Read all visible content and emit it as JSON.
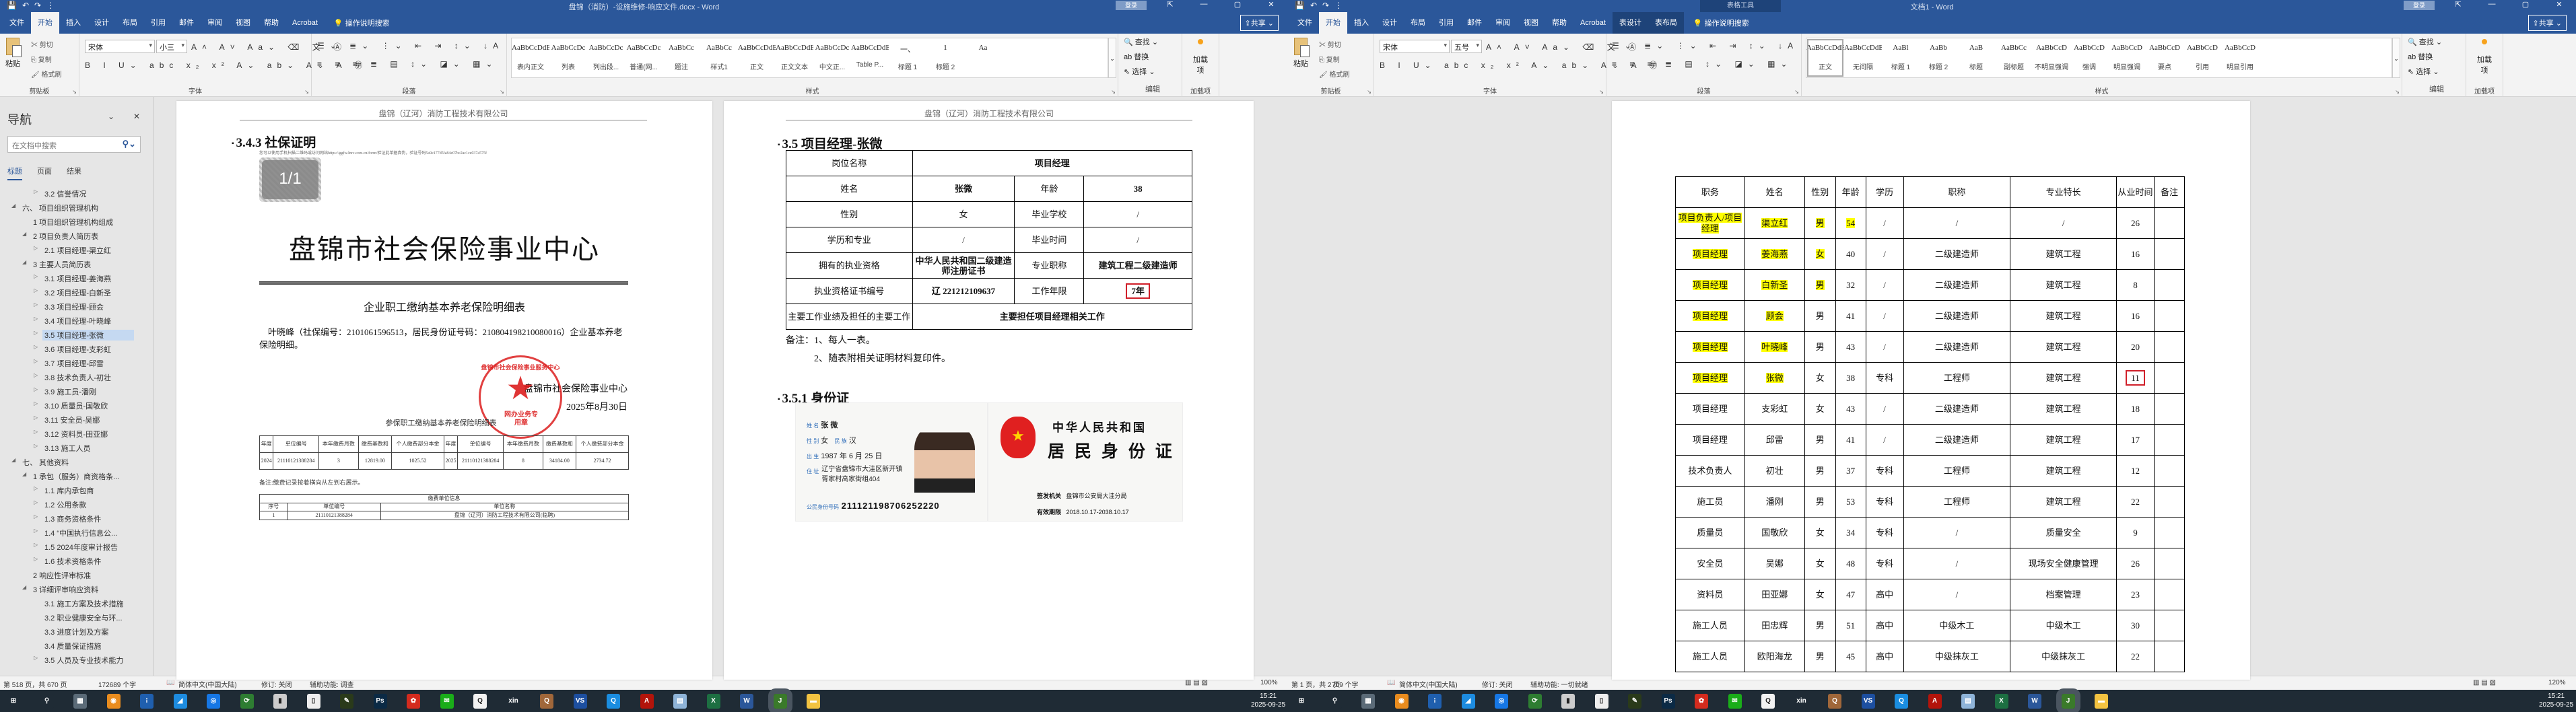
{
  "windows": {
    "left": {
      "title": "盘锦（消防）-设施维修-响应文件.docx - Word",
      "quick_access": [
        "save-icon",
        "undo-icon",
        "redo-icon",
        "customize-icon"
      ],
      "login": "登录",
      "share": "共享",
      "tabs": [
        "文件",
        "开始",
        "插入",
        "设计",
        "布局",
        "引用",
        "邮件",
        "审阅",
        "视图",
        "帮助",
        "Acrobat"
      ],
      "active_tab": "开始",
      "tell_me": "操作说明搜索",
      "ribbon": {
        "paste": "粘贴",
        "cut": "剪切",
        "copy": "复制",
        "format_painter": "格式刷",
        "clipboard_label": "剪贴板",
        "font_name": "宋体",
        "font_size": "小三",
        "font_label": "字体",
        "paragraph_label": "段落",
        "styles_label": "样式",
        "styles": [
          {
            "preview": "AaBbCcDdE",
            "name": "表内正文"
          },
          {
            "preview": "AaBbCcDc",
            "name": "列表"
          },
          {
            "preview": "AaBbCcDc",
            "name": "列出段..."
          },
          {
            "preview": "AaBbCcDc",
            "name": "普通(网..."
          },
          {
            "preview": "AaBbCc",
            "name": "题注"
          },
          {
            "preview": "AaBbCc",
            "name": "样式1"
          },
          {
            "preview": "AaBbCcDdE",
            "name": "正文"
          },
          {
            "preview": "AaBbCcDdE",
            "name": "正文文本"
          },
          {
            "preview": "AaBbCcDc",
            "name": "中文正..."
          },
          {
            "preview": "AaBbCcDdE",
            "name": "Table P..."
          },
          {
            "preview": "一、",
            "name": "标题 1"
          },
          {
            "preview": "1",
            "name": "标题 2"
          },
          {
            "preview": "Aa",
            "name": ""
          }
        ],
        "find": "查找",
        "replace": "替换",
        "select": "选择",
        "editing_label": "编辑",
        "addins_button": "加载项",
        "addins_label": "加载项"
      },
      "status": {
        "page": "第 518 页，共 670 页",
        "words": "172689 个字",
        "language": "简体中文(中国大陆)",
        "track": "修订: 关闭",
        "accessibility": "辅助功能: 调查",
        "zoom": "100%"
      }
    },
    "right": {
      "title": "文档1 - Word",
      "contextual": "表格工具",
      "quick_access": [
        "save-icon",
        "undo-icon",
        "redo-icon",
        "customize-icon"
      ],
      "login": "登录",
      "share": "共享",
      "tabs": [
        "文件",
        "开始",
        "插入",
        "设计",
        "布局",
        "引用",
        "邮件",
        "审阅",
        "视图",
        "帮助",
        "Acrobat",
        "表设计",
        "表布局"
      ],
      "active_tab": "开始",
      "tell_me": "操作说明搜索",
      "ribbon": {
        "paste": "粘贴",
        "cut": "剪切",
        "copy": "复制",
        "format_painter": "格式刷",
        "clipboard_label": "剪贴板",
        "font_name": "宋体",
        "font_size": "五号",
        "font_label": "字体",
        "paragraph_label": "段落",
        "styles_label": "样式",
        "styles": [
          {
            "preview": "AaBbCcDdE",
            "name": "正文"
          },
          {
            "preview": "AaBbCcDdE",
            "name": "无间隔"
          },
          {
            "preview": "AaBl",
            "name": "标题 1"
          },
          {
            "preview": "AaBb",
            "name": "标题 2"
          },
          {
            "preview": "AaB",
            "name": "标题"
          },
          {
            "preview": "AaBbCc",
            "name": "副标题"
          },
          {
            "preview": "AaBbCcD",
            "name": "不明显强调"
          },
          {
            "preview": "AaBbCcD",
            "name": "强调"
          },
          {
            "preview": "AaBbCcD",
            "name": "明显强调"
          },
          {
            "preview": "AaBbCcD",
            "name": "要点"
          },
          {
            "preview": "AaBbCcD",
            "name": "引用"
          },
          {
            "preview": "AaBbCcD",
            "name": "明显引用"
          }
        ],
        "find": "查找",
        "replace": "替换",
        "select": "选择",
        "editing_label": "编辑",
        "addins_button": "加载项",
        "addins_label": "加载项"
      },
      "status": {
        "page": "第 1 页，共 2 页",
        "words": "709 个字",
        "language": "简体中文(中国大陆)",
        "track": "修订: 关闭",
        "accessibility": "辅助功能: 一切就绪",
        "zoom": "120%"
      }
    }
  },
  "nav": {
    "title": "导航",
    "search_placeholder": "在文档中搜索",
    "tabs": [
      "标题",
      "页面",
      "结果"
    ],
    "items": [
      {
        "label": "3.2 信誉情况",
        "level": 3,
        "state": "collapsed"
      },
      {
        "label": "六、 项目组织管理机构",
        "level": 1,
        "state": "expanded"
      },
      {
        "label": "1 项目组织管理机构组成",
        "level": 2,
        "state": "none"
      },
      {
        "label": "2 项目负责人简历表",
        "level": 2,
        "state": "expanded"
      },
      {
        "label": "2.1 项目经理-渠立红",
        "level": 3,
        "state": "collapsed"
      },
      {
        "label": "3 主要人员简历表",
        "level": 2,
        "state": "expanded"
      },
      {
        "label": "3.1 项目经理-姜海燕",
        "level": 3,
        "state": "collapsed"
      },
      {
        "label": "3.2 项目经理-白新圣",
        "level": 3,
        "state": "collapsed"
      },
      {
        "label": "3.3 项目经理-顾会",
        "level": 3,
        "state": "collapsed"
      },
      {
        "label": "3.4 项目经理-叶晓峰",
        "level": 3,
        "state": "collapsed"
      },
      {
        "label": "3.5 项目经理-张微",
        "level": 3,
        "state": "collapsed",
        "selected": true
      },
      {
        "label": "3.6 项目经理-支彩虹",
        "level": 3,
        "state": "collapsed"
      },
      {
        "label": "3.7 项目经理-邱雷",
        "level": 3,
        "state": "collapsed"
      },
      {
        "label": "3.8 技术负责人-初壮",
        "level": 3,
        "state": "collapsed"
      },
      {
        "label": "3.9 施工员-潘刚",
        "level": 3,
        "state": "collapsed"
      },
      {
        "label": "3.10 质量员-国敬欣",
        "level": 3,
        "state": "collapsed"
      },
      {
        "label": "3.11 安全员-吴娜",
        "level": 3,
        "state": "collapsed"
      },
      {
        "label": "3.12 资料员-田亚娜",
        "level": 3,
        "state": "collapsed"
      },
      {
        "label": "3.13 施工人员",
        "level": 3,
        "state": "collapsed"
      },
      {
        "label": "七、 其他资料",
        "level": 1,
        "state": "expanded"
      },
      {
        "label": "1 承包（服务）商资格条...",
        "level": 2,
        "state": "expanded"
      },
      {
        "label": "1.1 库内承包商",
        "level": 3,
        "state": "collapsed"
      },
      {
        "label": "1.2 公用条款",
        "level": 3,
        "state": "collapsed"
      },
      {
        "label": "1.3 商务资格条件",
        "level": 3,
        "state": "collapsed"
      },
      {
        "label": "1.4 “中国执行信息公...",
        "level": 3,
        "state": "collapsed"
      },
      {
        "label": "1.5 2024年度审计报告",
        "level": 3,
        "state": "collapsed"
      },
      {
        "label": "1.6 技术资格条件",
        "level": 3,
        "state": "collapsed"
      },
      {
        "label": "2 响应性评审标准",
        "level": 2,
        "state": "none"
      },
      {
        "label": "3 详细评审响应资料",
        "level": 2,
        "state": "expanded"
      },
      {
        "label": "3.1 施工方案及技术措施",
        "level": 3,
        "state": "none"
      },
      {
        "label": "3.2 职业健康安全与环...",
        "level": 3,
        "state": "none"
      },
      {
        "label": "3.3 进度计划及方案",
        "level": 3,
        "state": "none"
      },
      {
        "label": "3.4 质量保证措施",
        "level": 3,
        "state": "none"
      },
      {
        "label": "3.5 人员及专业技术能力",
        "level": 3,
        "state": "collapsed"
      }
    ]
  },
  "page_header": "盘锦（辽河）消防工程技术有限公司",
  "page1": {
    "heading": "3.4.3 社保证明",
    "verify_text": "您可以使用手机扫描二维码或访问网站https://ggfw.lnrc.com.cn/form/验证此单据真伪，验证号码5a9e177d5fa84e07bc2ac1ce037a575f",
    "page_badge": "1/1",
    "org_title": "盘锦市社会保险事业中心",
    "subtitle": "企业职工缴纳基本养老保险明细表",
    "paragraph": "叶晓峰（社保编号：210106159​6513，居民身份证号码：210804198210080016）企业基本养老保险明细。",
    "stamp_ring": "盘锦市社会保险事业服务中心",
    "stamp_center": "网办业务专用章",
    "issuer": "盘锦市社会保险事业中心",
    "date": "2025年8月30日",
    "table_title": "参保职工缴纳基本养老保险明细表",
    "table_headers": [
      "年度",
      "单位编号",
      "本年缴费月数",
      "缴费基数和",
      "个人缴费部分本金",
      "年度",
      "单位编号",
      "本年缴费月数",
      "缴费基数和",
      "个人缴费部分本金"
    ],
    "table_row": [
      "2024",
      "21110121388284",
      "3",
      "12819.00",
      "1025.52",
      "2025",
      "21110121388284",
      "8",
      "34184.00",
      "2734.72"
    ],
    "note": "备注:缴费记录按着横向从左到右展示。",
    "unit_table_title": "缴费单位信息",
    "unit_headers": [
      "序号",
      "单位编号",
      "单位名称"
    ],
    "unit_row": [
      "1",
      "21110121388284",
      "盘锦（辽河）消防工程技术有限公司(临聘)"
    ]
  },
  "page2": {
    "heading": "3.5 项目经理-张微",
    "table": [
      [
        {
          "t": "岗位名称"
        },
        {
          "t": "项目经理",
          "span": 3,
          "b": true
        }
      ],
      [
        {
          "t": "姓名"
        },
        {
          "t": "张微",
          "b": true
        },
        {
          "t": "年龄"
        },
        {
          "t": "38",
          "b": true
        }
      ],
      [
        {
          "t": "性别"
        },
        {
          "t": "女"
        },
        {
          "t": "毕业学校"
        },
        {
          "t": "/"
        }
      ],
      [
        {
          "t": "学历和专业"
        },
        {
          "t": "/"
        },
        {
          "t": "毕业时间"
        },
        {
          "t": "/"
        }
      ],
      [
        {
          "t": "拥有的执业资格"
        },
        {
          "t": "中华人民共和国二级建造师注册证书",
          "b": true
        },
        {
          "t": "专业职称"
        },
        {
          "t": "建筑工程二级建造师",
          "b": true
        }
      ],
      [
        {
          "t": "执业资格证书编号"
        },
        {
          "t": "辽 221212109637",
          "b": true
        },
        {
          "t": "工作年限"
        },
        {
          "t": "7年",
          "b": true,
          "boxed": true
        }
      ],
      [
        {
          "t": "主要工作业绩及担任的主要工作"
        },
        {
          "t": "主要担任项目经理相关工作",
          "span": 3,
          "b": true
        }
      ]
    ],
    "note1": "备注：1、每人一表。",
    "note2": "2、随表附相关证明材料复印件。",
    "id_heading": "3.5.1 身份证",
    "id_front": {
      "name_label": "姓 名",
      "name": "张 微",
      "gender_label": "性 别",
      "gender": "女",
      "ethnic_label": "民 族",
      "ethnic": "汉",
      "birth_label": "出 生",
      "birth": "1987 年 6 月 25 日",
      "address_label": "住 址",
      "address": "辽宁省盘锦市大洼区新开镇胥家村高家街组404",
      "id_label": "公民身份号码",
      "id_number": "211121198706252220"
    },
    "id_back": {
      "country": "中华人民共和国",
      "card_title": "居 民 身 份 证",
      "authority_label": "签发机关",
      "authority": "盘锦市公安局大洼分局",
      "validity_label": "有效期限",
      "validity": "2018.10.17-2038.10.17"
    }
  },
  "page3": {
    "headers": [
      "职务",
      "姓名",
      "性别",
      "年龄",
      "学历",
      "职称",
      "专业特长",
      "从业时间",
      "备注"
    ],
    "rows": [
      {
        "cells": [
          "项目负责人/项目经理",
          "渠立红",
          "男",
          "54",
          "/",
          "/",
          "/",
          "26",
          ""
        ],
        "highlight": [
          0,
          1,
          2,
          3
        ]
      },
      {
        "cells": [
          "项目经理",
          "姜海燕",
          "女",
          "40",
          "/",
          "二级建造师",
          "建筑工程",
          "16",
          ""
        ],
        "highlight": [
          0,
          1,
          2
        ]
      },
      {
        "cells": [
          "项目经理",
          "白新圣",
          "男",
          "32",
          "/",
          "二级建造师",
          "建筑工程",
          "8",
          ""
        ],
        "highlight": [
          0,
          1,
          2
        ]
      },
      {
        "cells": [
          "项目经理",
          "顾会",
          "男",
          "41",
          "/",
          "二级建造师",
          "建筑工程",
          "16",
          ""
        ],
        "highlight": [
          0,
          1
        ]
      },
      {
        "cells": [
          "项目经理",
          "叶晓峰",
          "男",
          "43",
          "/",
          "二级建造师",
          "建筑工程",
          "20",
          ""
        ],
        "highlight": [
          0,
          1
        ]
      },
      {
        "cells": [
          "项目经理",
          "张微",
          "女",
          "38",
          "专科",
          "工程师",
          "建筑工程",
          "11",
          ""
        ],
        "highlight": [
          0,
          1
        ],
        "boxed": 7
      },
      {
        "cells": [
          "项目经理",
          "支彩虹",
          "女",
          "43",
          "/",
          "二级建造师",
          "建筑工程",
          "18",
          ""
        ]
      },
      {
        "cells": [
          "项目经理",
          "邱雷",
          "男",
          "41",
          "/",
          "二级建造师",
          "建筑工程",
          "17",
          ""
        ]
      },
      {
        "cells": [
          "技术负责人",
          "初壮",
          "男",
          "37",
          "专科",
          "工程师",
          "建筑工程",
          "12",
          ""
        ]
      },
      {
        "cells": [
          "施工员",
          "潘刚",
          "男",
          "53",
          "专科",
          "工程师",
          "建筑工程",
          "22",
          ""
        ]
      },
      {
        "cells": [
          "质量员",
          "国敬欣",
          "女",
          "34",
          "专科",
          "/",
          "质量安全",
          "9",
          ""
        ]
      },
      {
        "cells": [
          "安全员",
          "吴娜",
          "女",
          "48",
          "专科",
          "/",
          "现场安全健康管理",
          "26",
          ""
        ]
      },
      {
        "cells": [
          "资料员",
          "田亚娜",
          "女",
          "47",
          "高中",
          "/",
          "档案管理",
          "23",
          ""
        ]
      },
      {
        "cells": [
          "施工人员",
          "田忠辉",
          "男",
          "51",
          "高中",
          "中级木工",
          "中级木工",
          "30",
          ""
        ]
      },
      {
        "cells": [
          "施工人员",
          "欧阳海龙",
          "男",
          "45",
          "高中",
          "中级抹灰工",
          "中级抹灰工",
          "22",
          ""
        ]
      }
    ]
  },
  "taskbar": {
    "icons": [
      {
        "name": "start",
        "glyph": "⊞",
        "color": "#1f2b35"
      },
      {
        "name": "search",
        "glyph": "⚲",
        "color": "#1f2b35"
      },
      {
        "name": "calculator",
        "glyph": "▦",
        "color": "#5b6b78"
      },
      {
        "name": "camera-app",
        "glyph": "◉",
        "color": "#e98c1e"
      },
      {
        "name": "dots-app",
        "glyph": "⁝",
        "color": "#1f5fae"
      },
      {
        "name": "cloud-app",
        "glyph": "◢",
        "color": "#1d8ce0"
      },
      {
        "name": "ring-app",
        "glyph": "◎",
        "color": "#1677e5"
      },
      {
        "name": "sync-app",
        "glyph": "⟳",
        "color": "#2e7d32"
      },
      {
        "name": "scanner-app",
        "glyph": "▮",
        "color": "#ccc"
      },
      {
        "name": "document-app",
        "glyph": "▯",
        "color": "#eee"
      },
      {
        "name": "pen-app",
        "glyph": "✎",
        "color": "#2a3a1a"
      },
      {
        "name": "photoshop",
        "glyph": "Ps",
        "color": "#0b2a45"
      },
      {
        "name": "petrochina",
        "glyph": "✿",
        "color": "#d42b1e"
      },
      {
        "name": "wechat",
        "glyph": "✉",
        "color": "#1aad19"
      },
      {
        "name": "qq",
        "glyph": "Q",
        "color": "#f2f2f2"
      },
      {
        "name": "xin-app",
        "glyph": "xin",
        "color": "#1f2b35"
      },
      {
        "name": "chat-app",
        "glyph": "Q",
        "color": "#a0673a"
      },
      {
        "name": "vs-app",
        "glyph": "VS",
        "color": "#1d4fa0"
      },
      {
        "name": "browser-q",
        "glyph": "Q",
        "color": "#1a8de0"
      },
      {
        "name": "acrobat",
        "glyph": "A",
        "color": "#b3140b"
      },
      {
        "name": "notepad",
        "glyph": "▤",
        "color": "#8fb4d8"
      },
      {
        "name": "excel",
        "glyph": "X",
        "color": "#1d6f42"
      },
      {
        "name": "word",
        "glyph": "W",
        "color": "#2b579a"
      },
      {
        "name": "feather-app",
        "glyph": "J",
        "color": "#3a7a2a",
        "active": true
      },
      {
        "name": "file-explorer",
        "glyph": "▬",
        "color": "#f3c341"
      }
    ],
    "time": "15:21",
    "date": "2025-09-25"
  }
}
